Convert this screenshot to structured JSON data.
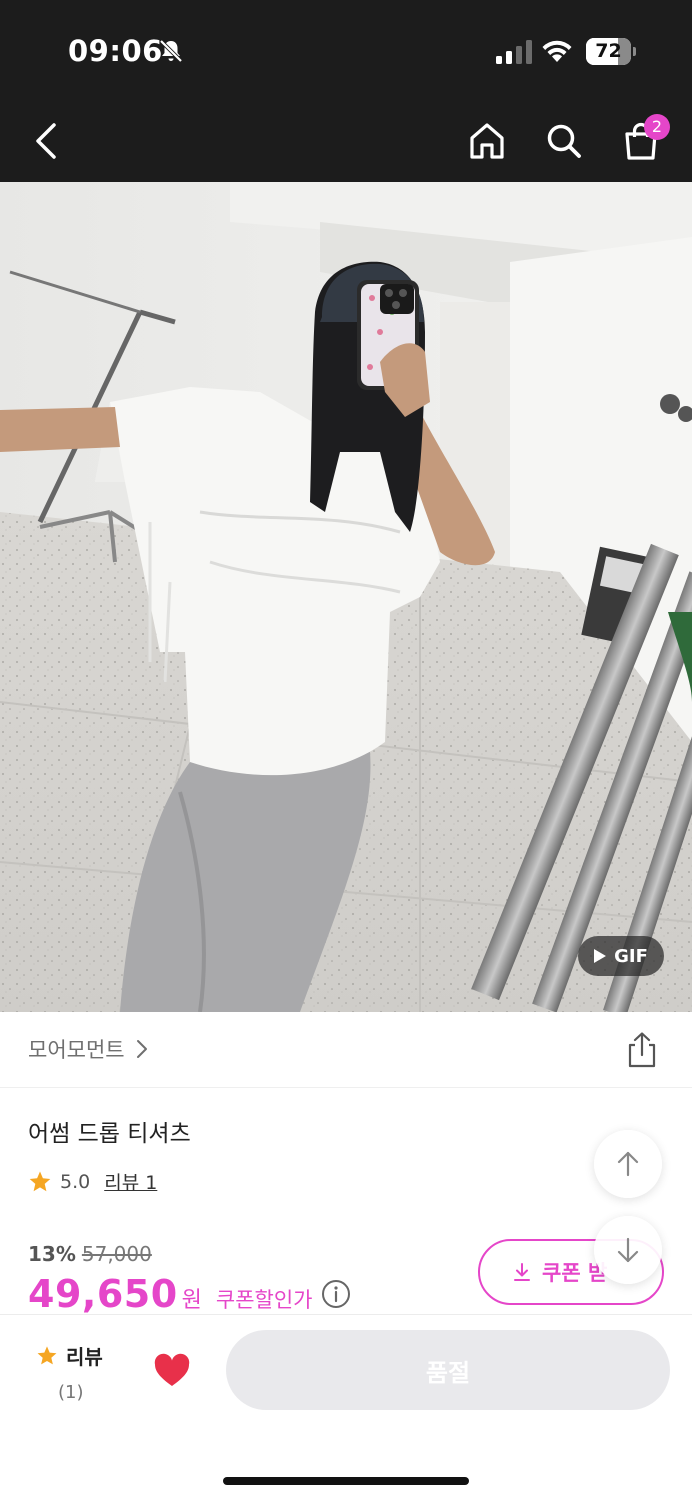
{
  "status_bar": {
    "time": "09:06",
    "battery_level": "72",
    "battery_fraction": 0.72,
    "icons": [
      "bell-slash-icon",
      "cellular-signal-icon",
      "wifi-icon",
      "battery-icon"
    ]
  },
  "nav": {
    "icons": [
      "chevron-left-icon",
      "home-icon",
      "search-icon",
      "shopping-bag-icon"
    ],
    "cart_badge": "2"
  },
  "hero": {
    "gif_label": "GIF"
  },
  "brand": {
    "name": "모어모먼트"
  },
  "product": {
    "title": "어썸 드롭 티셔츠",
    "rating": "5.0",
    "review_link": "리뷰 1",
    "discount_percent": "13%",
    "original_price": "57,000",
    "sale_price": "49,650",
    "price_unit": "원",
    "coupon_discount_label": "쿠폰할인가",
    "coupon_button": "쿠폰 받"
  },
  "bottom_bar": {
    "review_label": "리뷰",
    "review_count": "(1)",
    "soldout_label": "품절"
  },
  "colors": {
    "accent": "#e546c9",
    "header_bg": "#1c1c1c",
    "star": "#f5a623",
    "heart": "#e8304a",
    "soldout_bg": "#e9e9ec"
  }
}
